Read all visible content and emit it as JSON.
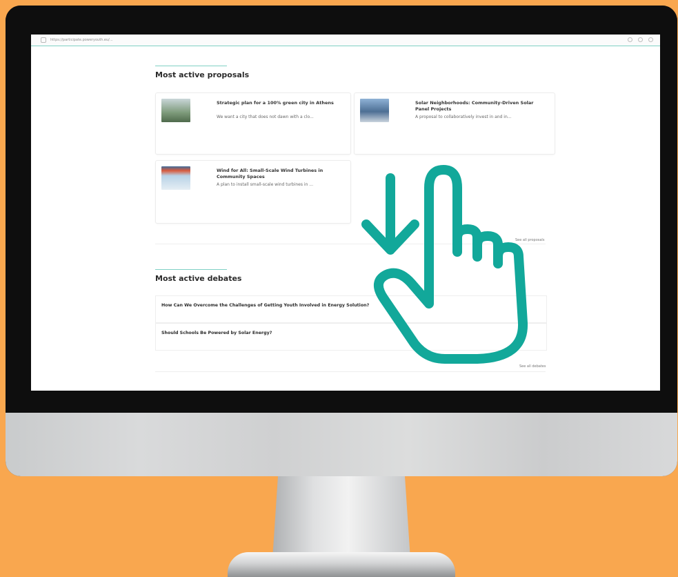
{
  "browser": {
    "url": "https://participate.poweryouth.eu/..."
  },
  "proposals": {
    "section_title": "Most active proposals",
    "items": [
      {
        "title": "Strategic plan for a 100% green city in Athens",
        "description": "We want a city that does not dawn with a clo...",
        "thumb_color": "#7d9a7a"
      },
      {
        "title": "Solar Neighborhoods: Community-Driven Solar Panel Projects",
        "description": "A proposal to collaboratively invest in and in...",
        "thumb_color": "#6f8fb0"
      },
      {
        "title": "Wind for All: Small-Scale Wind Turbines in Community Spaces",
        "description": "A plan to install small-scale wind turbines in ...",
        "thumb_color": "#3f6e9c"
      }
    ],
    "see_all": "See all proposals"
  },
  "debates": {
    "section_title": "Most active debates",
    "items": [
      {
        "title": "How Can We Overcome the Challenges of Getting Youth Involved in Energy Solution?"
      },
      {
        "title": "Should Schools Be Powered by Solar Energy?"
      }
    ],
    "see_all": "See all debates"
  },
  "colors": {
    "background": "#F9A74F",
    "accent": "#12A89A",
    "section_rule": "#7fd1c4"
  },
  "gesture": {
    "icon": "hand-swipe-down-icon"
  }
}
